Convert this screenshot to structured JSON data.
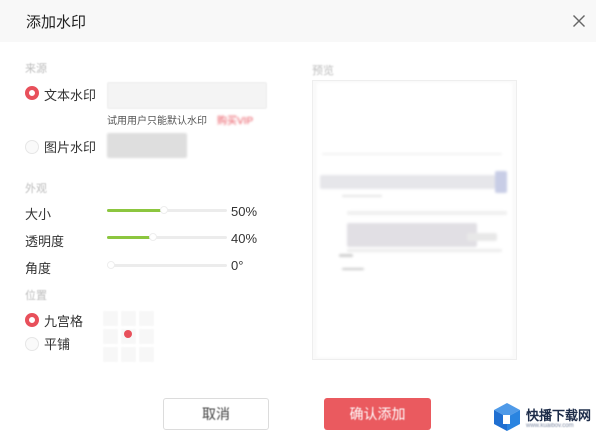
{
  "dialog": {
    "title": "添加水印",
    "close_icon": "close-icon"
  },
  "content_section": {
    "heading": "来源",
    "text_watermark": {
      "label": "文本水印",
      "selected": true,
      "input_value": ""
    },
    "trial_hint": "试用用户只能默认水印",
    "trial_link": "购买VIP",
    "image_watermark": {
      "label": "图片水印",
      "selected": false
    }
  },
  "appearance_section": {
    "heading": "外观",
    "size": {
      "label": "大小",
      "value": "50%",
      "level": 0.5
    },
    "opacity": {
      "label": "透明度",
      "value": "40%",
      "level": 0.4
    },
    "angle": {
      "label": "角度",
      "value": "0°",
      "level": 0.0
    }
  },
  "position_section": {
    "heading": "位置",
    "nine_grid": {
      "label": "九宫格",
      "selected": true,
      "active_cell": 4
    },
    "tile": {
      "label": "平铺",
      "selected": false
    }
  },
  "preview": {
    "heading": "预览"
  },
  "buttons": {
    "cancel": "取消",
    "confirm": "确认添加"
  },
  "brand": {
    "name": "快播下载网",
    "sub": "www.kuaibov.com"
  },
  "colors": {
    "accent": "#e8505b",
    "slider_fill": "#8cc63f",
    "confirm_bg": "#ea5a5f"
  }
}
